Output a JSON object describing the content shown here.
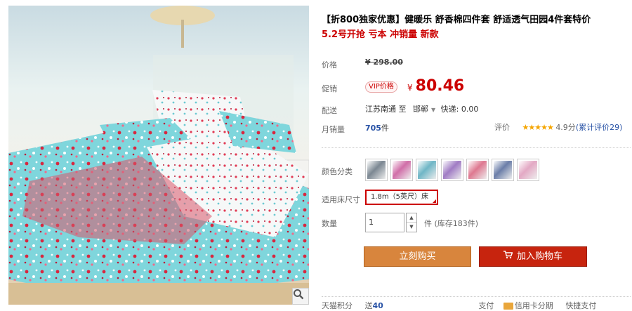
{
  "product": {
    "title": "【折800独家优惠】健暖乐 舒香棉四件套 舒适透气田园4件套特价",
    "subtitle": "5.2号开抢 亏本 冲销量 新款"
  },
  "price": {
    "label": "价格",
    "currency": "¥",
    "original": "298.00",
    "promo_label": "促销",
    "vip_badge": "VIP价格",
    "sale": "80.46"
  },
  "shipping": {
    "label": "配送",
    "from": "江苏南通",
    "to_word": "至",
    "dest": "邯郸",
    "fee": "快递: 0.00"
  },
  "sales": {
    "label": "月销量",
    "count": "705",
    "unit": "件",
    "review_label": "评价",
    "stars": "★★★★★",
    "score": "4.9分",
    "review_count": "(累计评价29)"
  },
  "options": {
    "color_label": "颜色分类",
    "colors": [
      "#7b8792",
      "#d06ea8",
      "#6fb6c6",
      "#a07cc4",
      "#de7890",
      "#6b7ea8",
      "#e3a8c4"
    ],
    "size_label": "适用床尺寸",
    "size_value": "1.8m（5英尺）床",
    "qty_label": "数量",
    "qty_value": "1",
    "qty_unit": "件",
    "stock": "(库存183件)"
  },
  "actions": {
    "buy": "立刻购买",
    "cart": "加入购物车"
  },
  "footer": {
    "points_label": "天猫积分",
    "points_prefix": "送",
    "points": "40",
    "pay_label": "支付",
    "card_pay": "信用卡分期",
    "quick_pay": "快捷支付"
  },
  "icons": {
    "zoom": "magnifier-icon",
    "cart": "shopping-cart-icon"
  }
}
